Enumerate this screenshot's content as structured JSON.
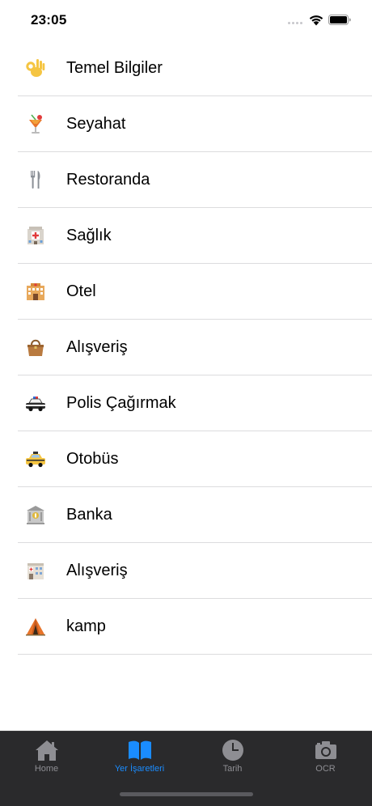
{
  "status_bar": {
    "time": "23:05"
  },
  "list": {
    "items": [
      {
        "label": "Temel Bilgiler",
        "icon": "ok-hand-icon"
      },
      {
        "label": "Seyahat",
        "icon": "tropical-drink-icon"
      },
      {
        "label": "Restoranda",
        "icon": "fork-knife-icon"
      },
      {
        "label": "Sağlık",
        "icon": "hospital-icon"
      },
      {
        "label": "Otel",
        "icon": "hotel-icon"
      },
      {
        "label": "Alışveriş",
        "icon": "handbag-icon"
      },
      {
        "label": "Polis Çağırmak",
        "icon": "police-car-icon"
      },
      {
        "label": "Otobüs",
        "icon": "taxi-icon"
      },
      {
        "label": "Banka",
        "icon": "bank-icon"
      },
      {
        "label": "Alışveriş",
        "icon": "hospital-building-icon"
      },
      {
        "label": "kamp",
        "icon": "tent-icon"
      }
    ]
  },
  "tab_bar": {
    "active_color": "#1a8cff",
    "inactive_color": "#8e8e93",
    "tabs": [
      {
        "label": "Home",
        "icon": "home-icon"
      },
      {
        "label": "Yer İşaretleri",
        "icon": "book-icon"
      },
      {
        "label": "Tarih",
        "icon": "clock-icon"
      },
      {
        "label": "OCR",
        "icon": "camera-icon"
      }
    ]
  }
}
